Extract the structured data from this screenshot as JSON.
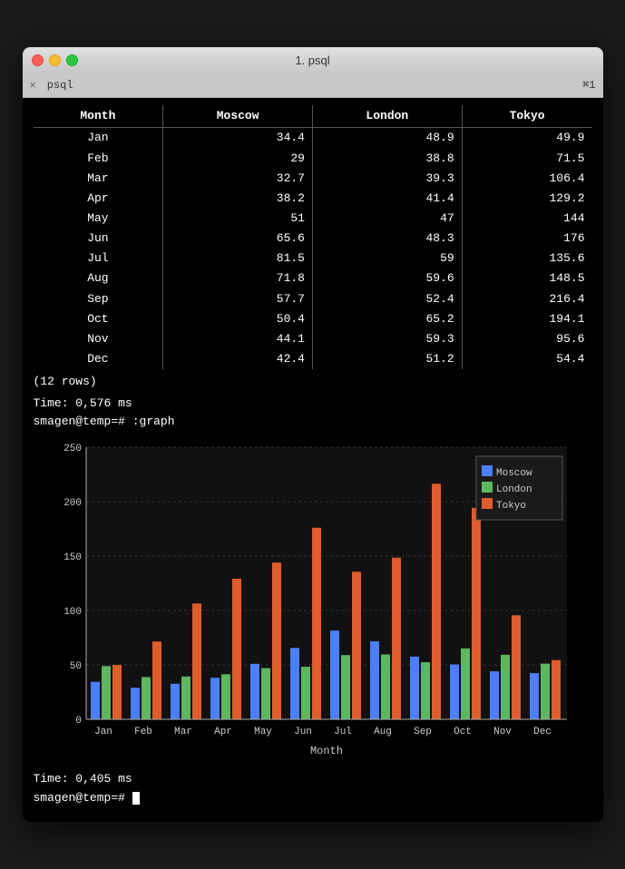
{
  "window": {
    "title": "1. psql",
    "tab_label": "psql",
    "tab_shortcut": "⌘1"
  },
  "table": {
    "headers": [
      "Month",
      "Moscow",
      "London",
      "Tokyo"
    ],
    "rows": [
      [
        "Jan",
        "34.4",
        "48.9",
        "49.9"
      ],
      [
        "Feb",
        "29",
        "38.8",
        "71.5"
      ],
      [
        "Mar",
        "32.7",
        "39.3",
        "106.4"
      ],
      [
        "Apr",
        "38.2",
        "41.4",
        "129.2"
      ],
      [
        "May",
        "51",
        "47",
        "144"
      ],
      [
        "Jun",
        "65.6",
        "48.3",
        "176"
      ],
      [
        "Jul",
        "81.5",
        "59",
        "135.6"
      ],
      [
        "Aug",
        "71.8",
        "59.6",
        "148.5"
      ],
      [
        "Sep",
        "57.7",
        "52.4",
        "216.4"
      ],
      [
        "Oct",
        "50.4",
        "65.2",
        "194.1"
      ],
      [
        "Nov",
        "44.1",
        "59.3",
        "95.6"
      ],
      [
        "Dec",
        "42.4",
        "51.2",
        "54.4"
      ]
    ],
    "footer": "(12 rows)"
  },
  "timing1": "Time: 0,576 ms",
  "prompt1": "smagen@temp=# :graph",
  "chart": {
    "y_axis_labels": [
      "0",
      "50",
      "100",
      "150",
      "200",
      "250"
    ],
    "x_label": "Month",
    "x_axis_labels": [
      "Jan",
      "Feb",
      "Mar",
      "Apr",
      "May",
      "Jun",
      "Jul",
      "Aug",
      "Sep",
      "Oct",
      "Nov",
      "Dec"
    ],
    "legend": [
      {
        "label": "Moscow",
        "color": "#4a7fff"
      },
      {
        "label": "London",
        "color": "#5cb85c"
      },
      {
        "label": "Tokyo",
        "color": "#e05c2a"
      }
    ],
    "data": {
      "Moscow": [
        34.4,
        29,
        32.7,
        38.2,
        51,
        65.6,
        81.5,
        71.8,
        57.7,
        50.4,
        44.1,
        42.4
      ],
      "London": [
        48.9,
        38.8,
        39.3,
        41.4,
        47,
        48.3,
        59,
        59.6,
        52.4,
        65.2,
        59.3,
        51.2
      ],
      "Tokyo": [
        49.9,
        71.5,
        106.4,
        129.2,
        144,
        176,
        135.6,
        148.5,
        216.4,
        194.1,
        95.6,
        54.4
      ]
    }
  },
  "timing2": "Time: 0,405 ms",
  "prompt2": "smagen@temp=# "
}
